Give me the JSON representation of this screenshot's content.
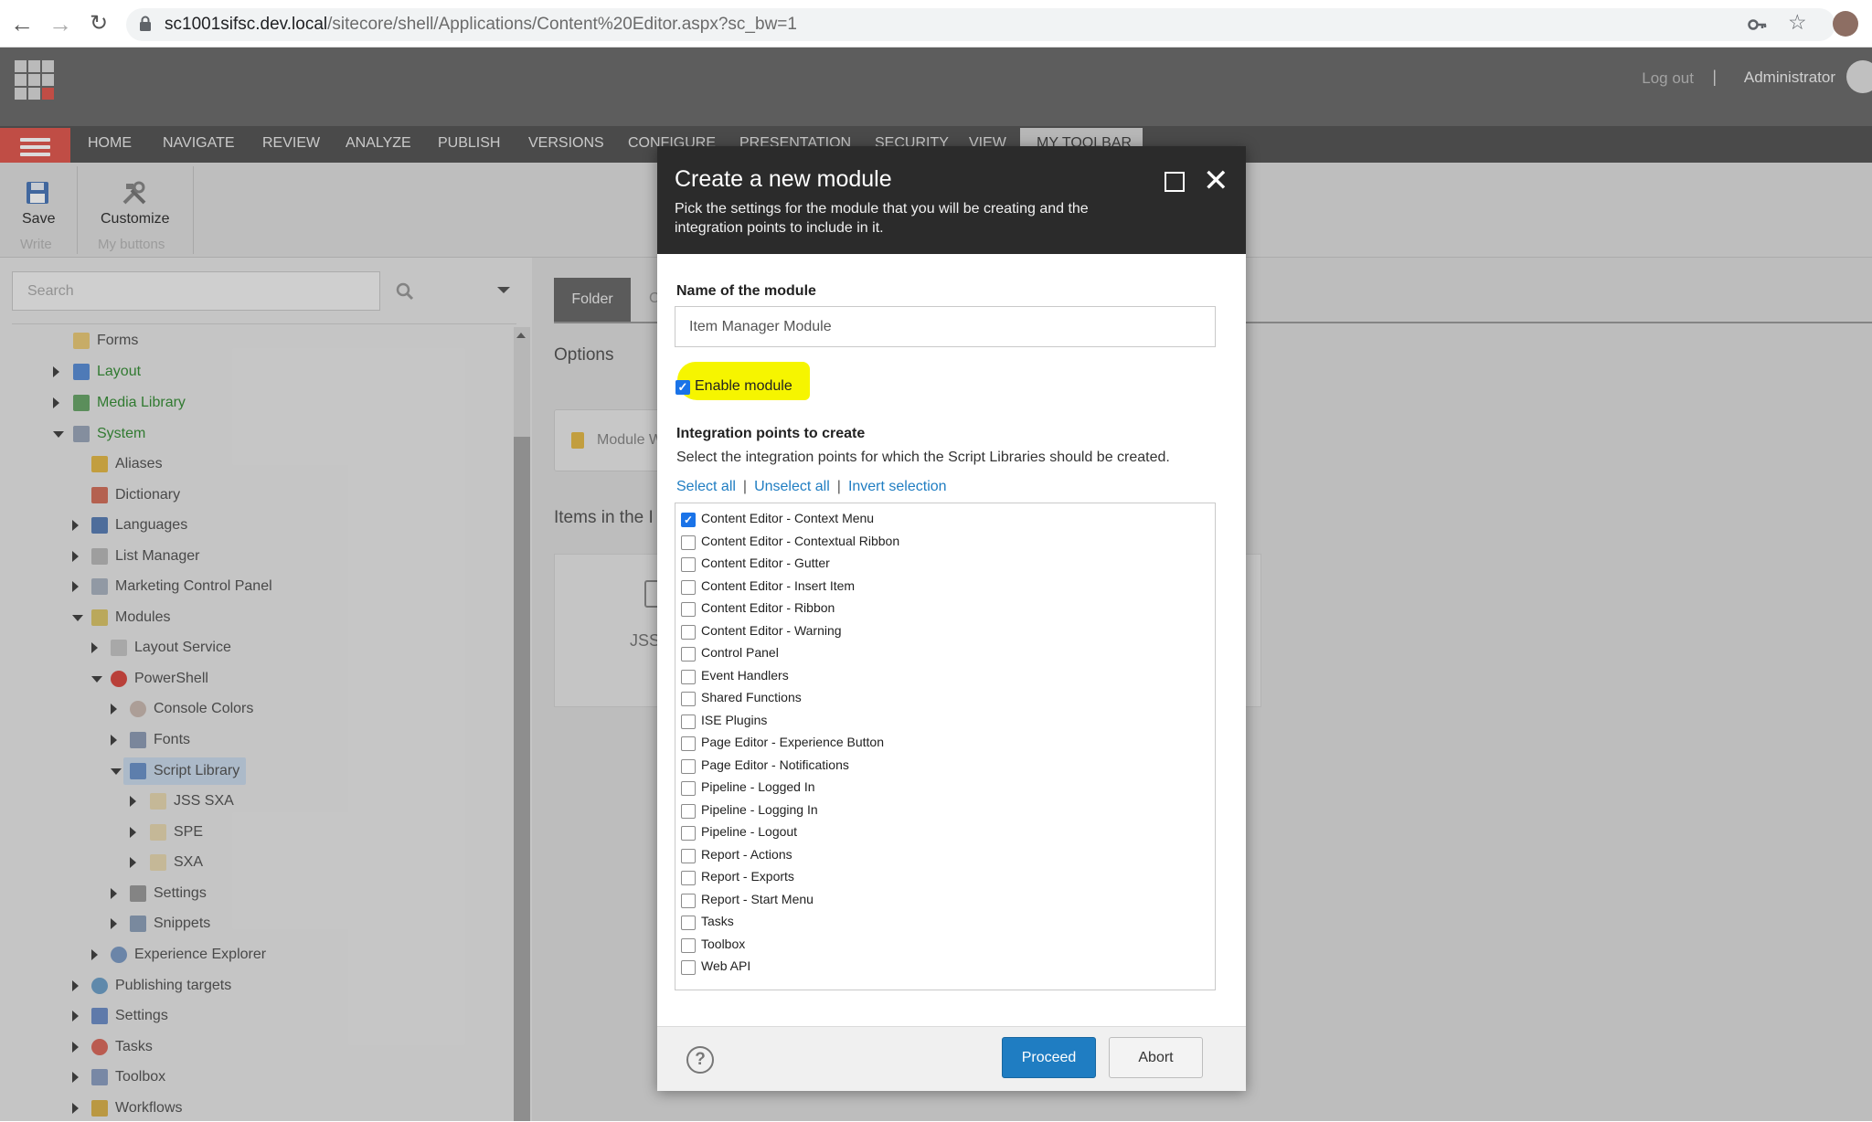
{
  "browser": {
    "url_host": "sc1001sifsc.dev.local",
    "url_path": "/sitecore/shell/Applications/Content%20Editor.aspx?sc_bw=1"
  },
  "header": {
    "logout": "Log out",
    "separator": "|",
    "user": "Administrator"
  },
  "ribbon": {
    "tabs": [
      "HOME",
      "NAVIGATE",
      "REVIEW",
      "ANALYZE",
      "PUBLISH",
      "VERSIONS",
      "CONFIGURE",
      "PRESENTATION",
      "SECURITY",
      "VIEW",
      "MY TOOLBAR"
    ],
    "save_label": "Save",
    "write_group": "Write",
    "customize_label": "Customize",
    "mybuttons_group": "My buttons"
  },
  "tree": {
    "search_placeholder": "Search",
    "items": [
      {
        "label": "Forms"
      },
      {
        "label": "Layout"
      },
      {
        "label": "Media Library"
      },
      {
        "label": "System"
      },
      {
        "label": "Aliases"
      },
      {
        "label": "Dictionary"
      },
      {
        "label": "Languages"
      },
      {
        "label": "List Manager"
      },
      {
        "label": "Marketing Control Panel"
      },
      {
        "label": "Modules"
      },
      {
        "label": "Layout Service"
      },
      {
        "label": "PowerShell"
      },
      {
        "label": "Console Colors"
      },
      {
        "label": "Fonts"
      },
      {
        "label": "Script Library"
      },
      {
        "label": "JSS SXA"
      },
      {
        "label": "SPE"
      },
      {
        "label": "SXA"
      },
      {
        "label": "Settings"
      },
      {
        "label": "Snippets"
      },
      {
        "label": "Experience Explorer"
      },
      {
        "label": "Publishing targets"
      },
      {
        "label": "Settings"
      },
      {
        "label": "Tasks"
      },
      {
        "label": "Toolbox"
      },
      {
        "label": "Workflows"
      }
    ]
  },
  "content": {
    "folder_tab": "Folder",
    "tab_c": "C",
    "options": "Options",
    "module_card": "Module W",
    "items_heading": "Items in the I",
    "jss": "JSS"
  },
  "dialog": {
    "title": "Create a new module",
    "subtitle": "Pick the settings for the module that you will be creating and the integration points to include in it.",
    "name_label": "Name of the module",
    "name_value": "Item Manager Module",
    "enable_label": "Enable module",
    "ip_title": "Integration points to create",
    "ip_desc": "Select the integration points for which the Script Libraries should be created.",
    "select_all": "Select all",
    "unselect_all": "Unselect all",
    "invert_selection": "Invert selection",
    "link_sep": "|",
    "integration_points": [
      {
        "label": "Content Editor - Context Menu",
        "checked": true
      },
      {
        "label": "Content Editor - Contextual Ribbon",
        "checked": false
      },
      {
        "label": "Content Editor - Gutter",
        "checked": false
      },
      {
        "label": "Content Editor - Insert Item",
        "checked": false
      },
      {
        "label": "Content Editor - Ribbon",
        "checked": false
      },
      {
        "label": "Content Editor - Warning",
        "checked": false
      },
      {
        "label": "Control Panel",
        "checked": false
      },
      {
        "label": "Event Handlers",
        "checked": false
      },
      {
        "label": "Shared Functions",
        "checked": false
      },
      {
        "label": "ISE Plugins",
        "checked": false
      },
      {
        "label": "Page Editor - Experience Button",
        "checked": false
      },
      {
        "label": "Page Editor - Notifications",
        "checked": false
      },
      {
        "label": "Pipeline - Logged In",
        "checked": false
      },
      {
        "label": "Pipeline - Logging In",
        "checked": false
      },
      {
        "label": "Pipeline - Logout",
        "checked": false
      },
      {
        "label": "Report - Actions",
        "checked": false
      },
      {
        "label": "Report - Exports",
        "checked": false
      },
      {
        "label": "Report - Start Menu",
        "checked": false
      },
      {
        "label": "Tasks",
        "checked": false
      },
      {
        "label": "Toolbox",
        "checked": false
      },
      {
        "label": "Web API",
        "checked": false
      }
    ],
    "proceed": "Proceed",
    "abort": "Abort",
    "help": "?"
  },
  "colors": {
    "accent": "#1f7dc2",
    "hamburger": "#e05a51",
    "highlight": "#f6f500",
    "tree_green": "#3a8f3a"
  }
}
